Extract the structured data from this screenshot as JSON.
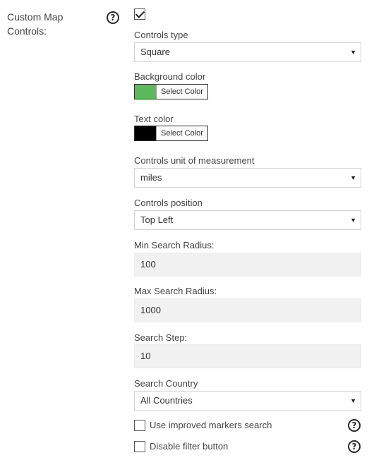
{
  "section": {
    "label": "Custom Map Controls:",
    "enabled": true
  },
  "controls_type": {
    "label": "Controls type",
    "value": "Square"
  },
  "background_color": {
    "label": "Background color",
    "button": "Select Color",
    "color": "#5cb85c"
  },
  "text_color": {
    "label": "Text color",
    "button": "Select Color",
    "color": "#000000"
  },
  "unit": {
    "label": "Controls unit of measurement",
    "value": "miles"
  },
  "position": {
    "label": "Controls position",
    "value": "Top Left"
  },
  "min_radius": {
    "label": "Min Search Radius:",
    "value": "100"
  },
  "max_radius": {
    "label": "Max Search Radius:",
    "value": "1000"
  },
  "step": {
    "label": "Search Step:",
    "value": "10"
  },
  "country": {
    "label": "Search Country",
    "value": "All Countries"
  },
  "improved_search": {
    "label": "Use improved markers search",
    "checked": false
  },
  "disable_filter": {
    "label": "Disable filter button",
    "checked": false
  },
  "icons": {
    "help": "help-circle-icon",
    "dropdown": "dropdown-arrow-icon",
    "check": "checkmark-icon"
  },
  "glyphs": {
    "help": "?",
    "arrow": "▼"
  }
}
